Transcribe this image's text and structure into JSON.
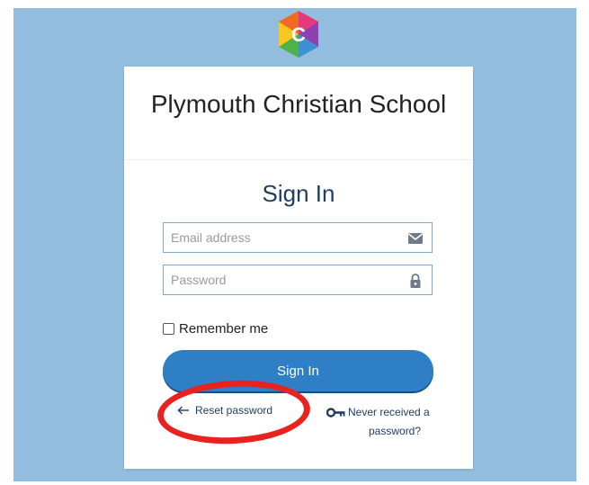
{
  "app": {
    "logo_icon": "hexagon-c-logo-icon",
    "school_name": "Plymouth Christian School"
  },
  "signin": {
    "title": "Sign In",
    "email_placeholder": "Email address",
    "email_value": "",
    "email_icon": "envelope-icon",
    "password_placeholder": "Password",
    "password_value": "",
    "password_icon": "lock-icon",
    "remember_label": "Remember me",
    "remember_checked": false,
    "button_label": "Sign In",
    "reset_label": "Reset password",
    "reset_icon": "arrow-left-icon",
    "never_received_line1": "Never received a",
    "never_received_line2": "password?",
    "never_received_icon": "key-icon"
  },
  "colors": {
    "background": "#92bddf",
    "accent": "#2f7fc6",
    "title_text": "#1f3e63",
    "highlight": "#e8231f"
  }
}
